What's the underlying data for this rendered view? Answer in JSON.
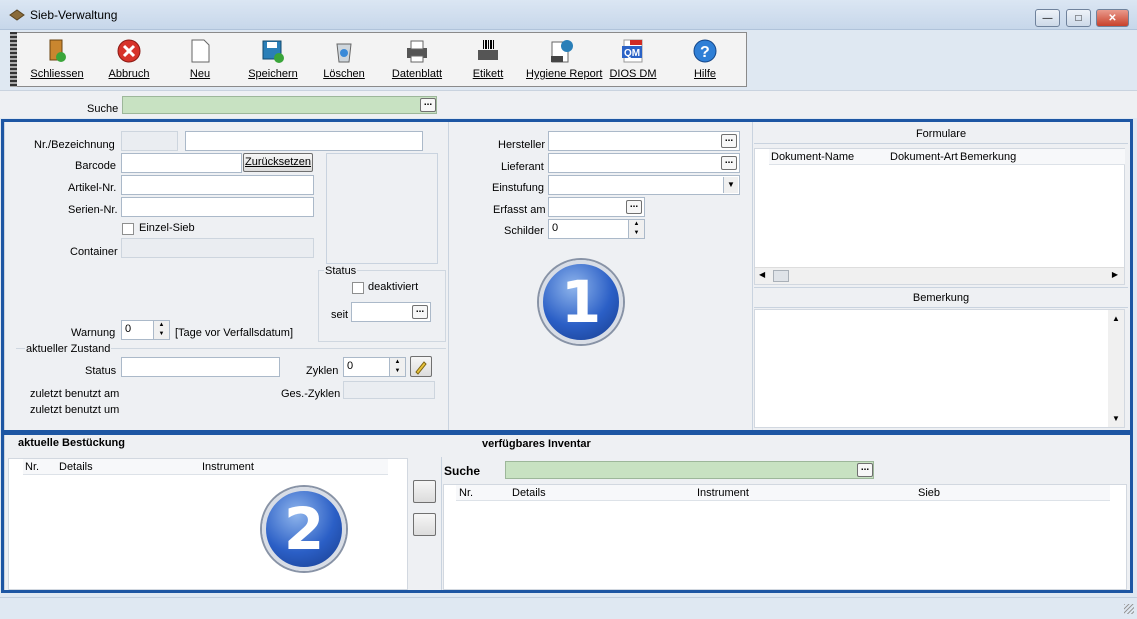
{
  "window": {
    "title": "Sieb-Verwaltung"
  },
  "toolbar": {
    "items": [
      {
        "label": "Schliessen",
        "icon": "exit-door-icon"
      },
      {
        "label": "Abbruch",
        "icon": "cancel-icon"
      },
      {
        "label": "Neu",
        "icon": "new-document-icon"
      },
      {
        "label": "Speichern",
        "icon": "save-icon"
      },
      {
        "label": "Löschen",
        "icon": "recycle-bin-icon"
      },
      {
        "label": "Datenblatt",
        "icon": "printer-icon"
      },
      {
        "label": "Etikett",
        "icon": "barcode-printer-icon"
      },
      {
        "label": "Hygiene Report",
        "icon": "report-icon"
      },
      {
        "label": "DIOS DM",
        "icon": "pdf-qm-icon"
      },
      {
        "label": "Hilfe",
        "icon": "help-icon"
      }
    ]
  },
  "search": {
    "label": "Suche",
    "value": ""
  },
  "form": {
    "nr_label": "Nr./Bezeichnung",
    "barcode_label": "Barcode",
    "reset_label": "Zurücksetzen",
    "artikel_label": "Artikel-Nr.",
    "serien_label": "Serien-Nr.",
    "einzel_label": "Einzel-Sieb",
    "container_label": "Container",
    "status_group": "Status",
    "deaktiviert_label": "deaktiviert",
    "seit_label": "seit",
    "warnung_label": "Warnung",
    "warnung_value": "0",
    "warnung_unit": "[Tage vor Verfallsdatum]",
    "zustand_group": "aktueller Zustand",
    "status_label": "Status",
    "zyklen_label": "Zyklen",
    "zyklen_value": "0",
    "zuletzt_am_label": "zuletzt benutzt am",
    "ges_zyklen_label": "Ges.-Zyklen",
    "zuletzt_um_label": "zuletzt benutzt um"
  },
  "middle": {
    "hersteller_label": "Hersteller",
    "lieferant_label": "Lieferant",
    "einstufung_label": "Einstufung",
    "erfasst_label": "Erfasst am",
    "schilder_label": "Schilder",
    "schilder_value": "0",
    "badge": "1"
  },
  "formulare": {
    "title": "Formulare",
    "columns": [
      "Dokument-Name",
      "Dokument-Art",
      "Bemerkung"
    ]
  },
  "bemerkung": {
    "title": "Bemerkung"
  },
  "bestueckung": {
    "title": "aktuelle Bestückung",
    "columns": [
      "Nr.",
      "Details",
      "Instrument"
    ],
    "badge": "2"
  },
  "inventar": {
    "title": "verfügbares Inventar",
    "search_label": "Suche",
    "columns": [
      "Nr.",
      "Details",
      "Instrument",
      "Sieb"
    ]
  },
  "colors": {
    "accent_frame": "#1d56a3",
    "search_bg": "#c8e2c2"
  }
}
